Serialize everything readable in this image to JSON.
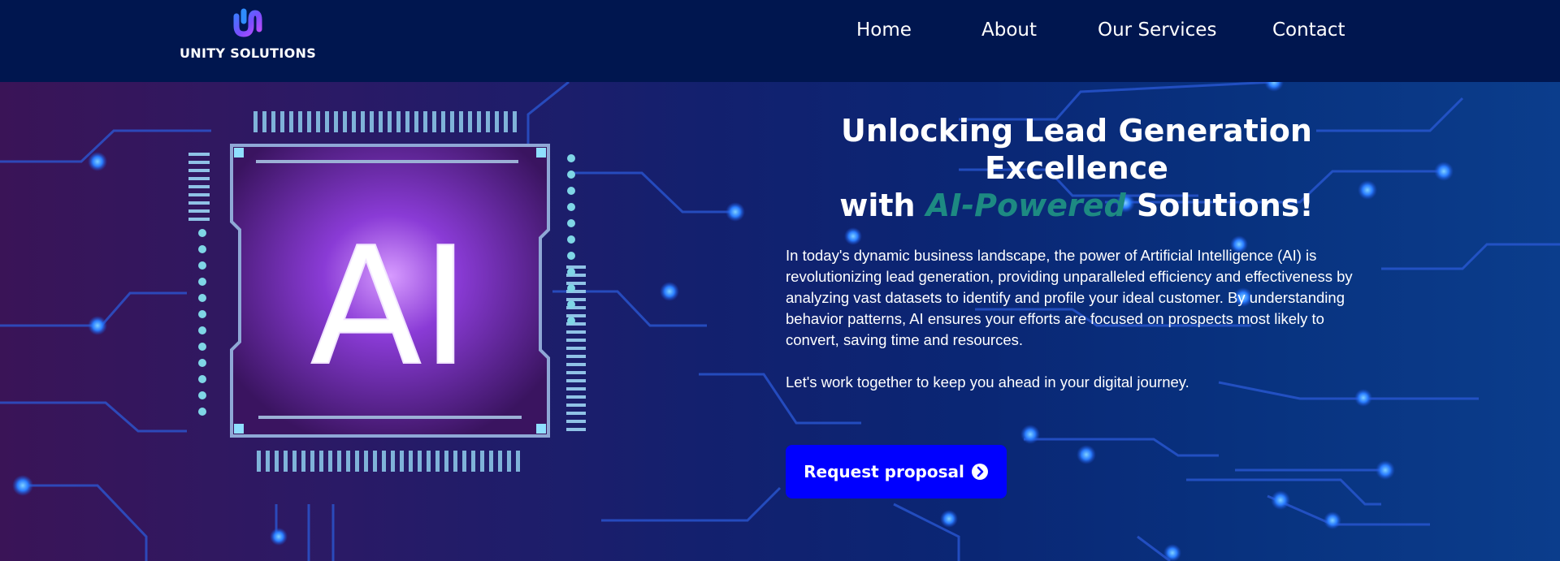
{
  "header": {
    "brand_name": "UNITY SOLUTIONS",
    "logo_icon": "unity-solutions-logo",
    "nav": [
      "Home",
      "About",
      "Our Services",
      "Contact"
    ]
  },
  "hero": {
    "title_line1": "Unlocking Lead Generation Excellence",
    "title_with": "with ",
    "title_accent": "AI-Powered",
    "title_end": " Solutions!",
    "chip_text": "AI",
    "paragraph1": "In today's dynamic business landscape, the power of Artificial Intelligence (AI) is revolutionizing lead generation, providing unparalleled efficiency and effectiveness by analyzing vast datasets to identify and profile your ideal customer. By understanding behavior patterns, AI ensures your efforts are focused on prospects most likely to convert, saving time and resources.",
    "paragraph2": "Let's work together to keep you ahead in your digital journey.",
    "cta_label": "Request proposal",
    "cta_icon": "chevron-right-circle-icon"
  },
  "colors": {
    "header_bg": "#00164f",
    "accent_text": "#1d8a82",
    "cta_bg": "#0000ff"
  }
}
